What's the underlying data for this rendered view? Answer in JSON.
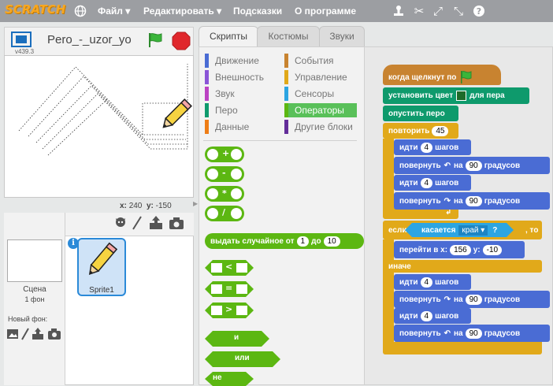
{
  "app": {
    "logo": "SCRATCH"
  },
  "menu": {
    "file": "Файл ▾",
    "edit": "Редактировать ▾",
    "tips": "Подсказки",
    "about": "О программе"
  },
  "stage": {
    "project_name": "Pero_-_uzor_yo",
    "version": "v439.3",
    "x_label": "x:",
    "x_value": "240",
    "y_label": "y:",
    "y_value": "-150"
  },
  "sprites_pane": {
    "scene_label": "Сцена",
    "scene_backdrops": "1 фон",
    "new_backdrop": "Новый фон:",
    "sprite_name": "Sprite1"
  },
  "tabs": {
    "scripts": "Скрипты",
    "costumes": "Костюмы",
    "sounds": "Звуки"
  },
  "categories": [
    {
      "label": "Движение",
      "color": "#4a6cd4"
    },
    {
      "label": "События",
      "color": "#c88330"
    },
    {
      "label": "Внешность",
      "color": "#8a55d7"
    },
    {
      "label": "Управление",
      "color": "#e1a91a"
    },
    {
      "label": "Звук",
      "color": "#bb42c3"
    },
    {
      "label": "Сенсоры",
      "color": "#2ca5e2"
    },
    {
      "label": "Перо",
      "color": "#0e9a6c"
    },
    {
      "label": "Операторы",
      "color": "#5cb712"
    },
    {
      "label": "Данные",
      "color": "#ee7d16"
    },
    {
      "label": "Другие блоки",
      "color": "#632d99"
    }
  ],
  "palette": {
    "add": "+",
    "sub": "-",
    "mul": "*",
    "div": "/",
    "random_a": "выдать случайное от",
    "random_n1": "1",
    "random_b": "до",
    "random_n2": "10",
    "lt": "<",
    "eq": "=",
    "gt": ">",
    "and": "и",
    "or": "или",
    "not": "не"
  },
  "script": {
    "hat": "когда щелкнут по",
    "set_color": "установить цвет",
    "set_color_b": "для пера",
    "pen_down": "опустить перо",
    "repeat": "повторить",
    "repeat_n": "45",
    "move": "идти",
    "move_n": "4",
    "steps": "шагов",
    "turn": "повернуть",
    "on": "на",
    "turn_n": "90",
    "degrees": "градусов",
    "if": "если",
    "touching": "касается",
    "edge": "край ▾",
    "q": "?",
    "then": ", то",
    "goto": "перейти в x:",
    "goto_x": "156",
    "goto_y_label": "y:",
    "goto_y": "-10",
    "else": "иначе"
  }
}
